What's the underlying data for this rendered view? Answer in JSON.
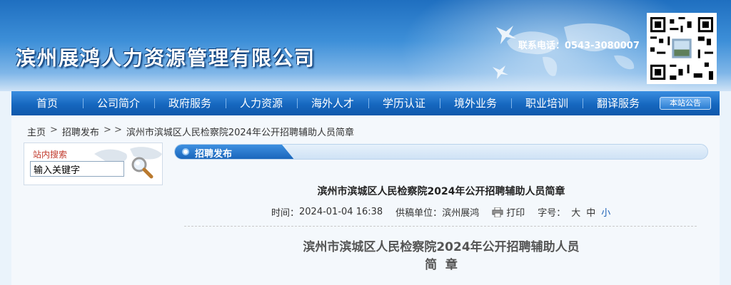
{
  "header": {
    "company_name": "滨州展鸿人力资源管理有限公司",
    "hotline": "联系电话：0543-3080007",
    "qr_icon": "qr-code-icon"
  },
  "nav": {
    "items": [
      "首页",
      "公司简介",
      "政府服务",
      "人力资源",
      "海外人才",
      "学历认证",
      "境外业务",
      "职业培训",
      "翻译服务"
    ],
    "badge": "本站公告"
  },
  "breadcrumb": {
    "home": "主页",
    "sep1": ">",
    "category": "招聘发布",
    "sep2": "> >",
    "current": "滨州市滨城区人民检察院2024年公开招聘辅助人员简章"
  },
  "search": {
    "title": "站内搜索",
    "value": "输入关键字",
    "icon": "magnifier-icon"
  },
  "section": {
    "label": "招聘发布"
  },
  "article": {
    "title": "滨州市滨城区人民检察院2024年公开招聘辅助人员简章",
    "time_label": "时间：",
    "time_value": "2024-01-04 16:38",
    "source_label": "供稿单位：",
    "source_value": "滨州展鸿",
    "print_label": "打印",
    "fontsize_label": "字号：",
    "size_large": "大",
    "size_medium": "中",
    "size_small": "小",
    "body_title_line1": "滨州市滨城区人民检察院2024年公开招聘辅助人员",
    "body_title_line2": "简  章"
  },
  "colors": {
    "nav_blue": "#1667bf",
    "header_blue": "#3d8fd8",
    "link_blue": "#1a5fb4",
    "search_title_red": "#c0392b"
  }
}
